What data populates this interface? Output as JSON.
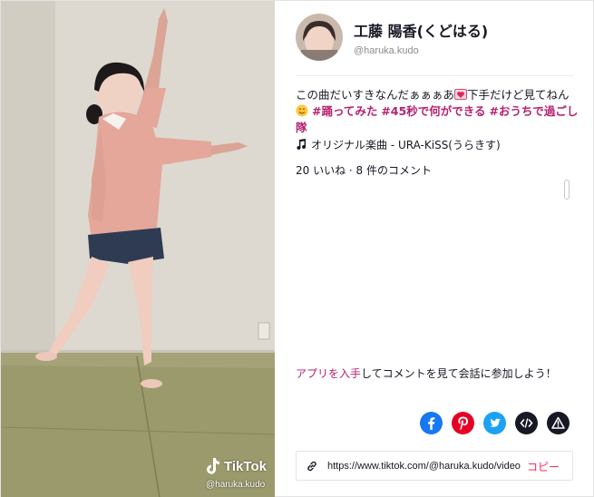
{
  "author": {
    "display_name": "工藤 陽香(くどはる)",
    "username": "@haruka.kudo"
  },
  "caption": {
    "text_before_emoji": "この曲だいすきなんだぁぁぁあ",
    "text_after_emoji": "下手だけど見てねん",
    "hashtags": [
      "#踊ってみた",
      "#45秒で何ができる",
      "#おうちで過ごし隊"
    ]
  },
  "music": {
    "label": "オリジナル楽曲 - URA-KiSS(うらきす)"
  },
  "stats": {
    "text": "20 いいね · 8 件のコメント"
  },
  "cta": {
    "link_text": "アプリを入手",
    "rest_text": "してコメントを見て会話に参加しよう！"
  },
  "share_buttons": [
    {
      "name": "facebook",
      "color": "#1877f2"
    },
    {
      "name": "pinterest",
      "color": "#e60023"
    },
    {
      "name": "twitter",
      "color": "#1da1f2"
    },
    {
      "name": "embed",
      "color": "#161823"
    },
    {
      "name": "report",
      "color": "#161823"
    }
  ],
  "link_box": {
    "url": "https://www.tiktok.com/@haruka.kudo/video",
    "copy_label": "コピー"
  },
  "video": {
    "watermark_brand": "TikTok",
    "watermark_handle": "@haruka.kudo"
  },
  "colors": {
    "hashtag": "#b6216e",
    "copy": "#fe2c55",
    "text": "#161823",
    "muted": "#8a8b91"
  }
}
